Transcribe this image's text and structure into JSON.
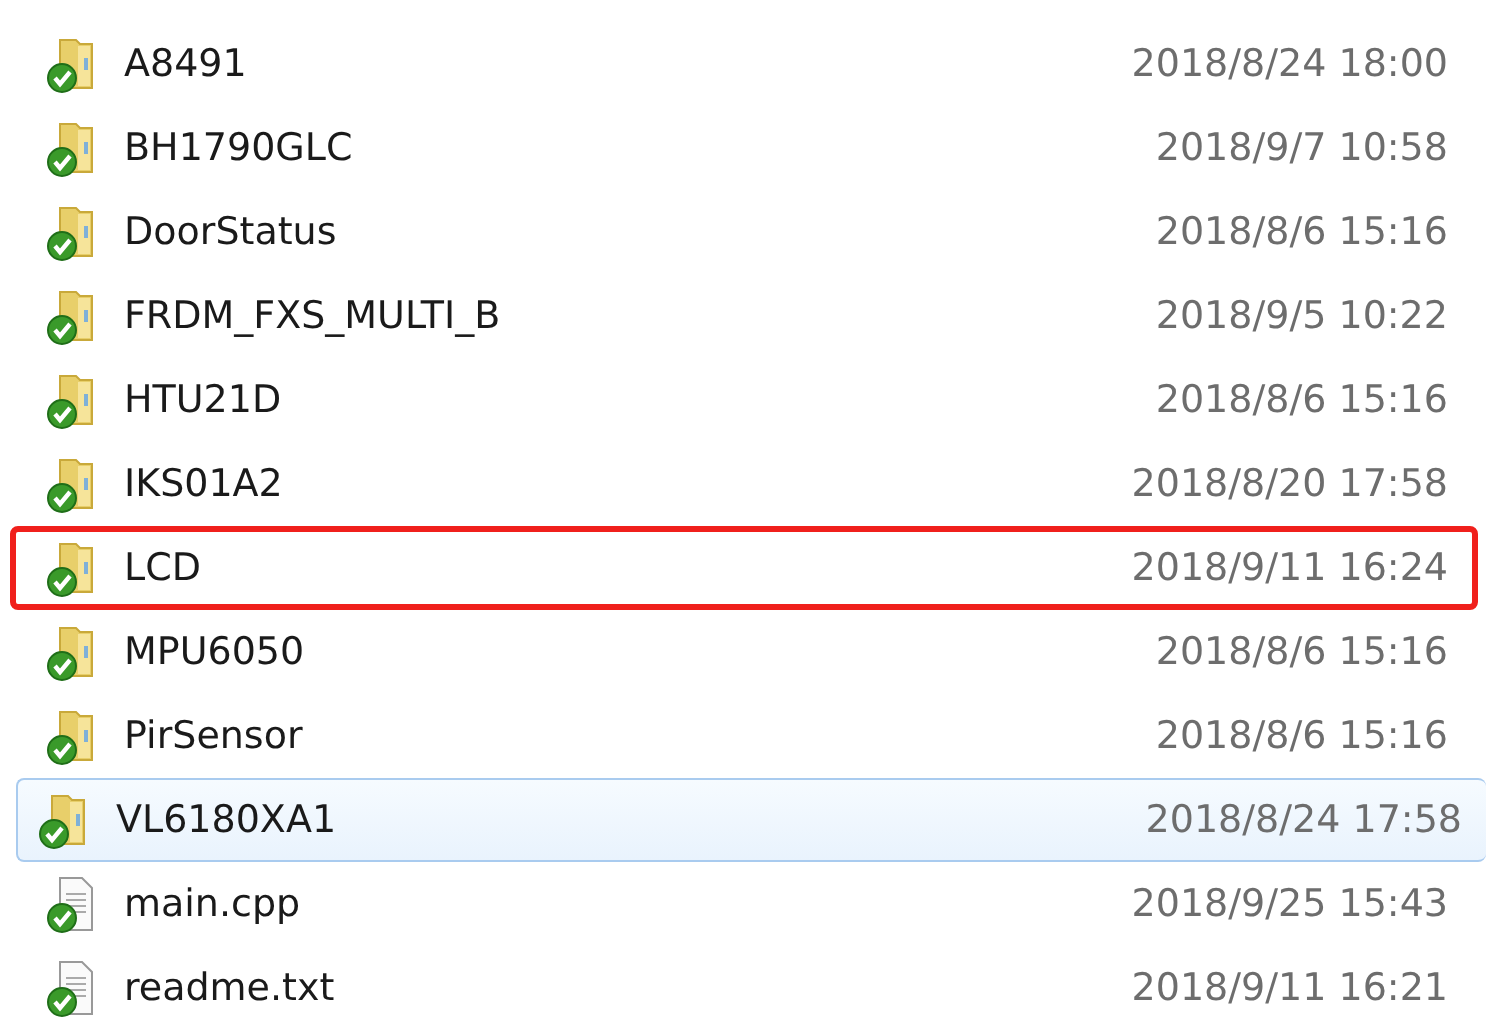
{
  "files": [
    {
      "kind": "folder",
      "name": "A8491",
      "modified": "2018/8/24 18:00",
      "hovered": false,
      "marked": false
    },
    {
      "kind": "folder",
      "name": "BH1790GLC",
      "modified": "2018/9/7 10:58",
      "hovered": false,
      "marked": false
    },
    {
      "kind": "folder",
      "name": "DoorStatus",
      "modified": "2018/8/6 15:16",
      "hovered": false,
      "marked": false
    },
    {
      "kind": "folder",
      "name": "FRDM_FXS_MULTI_B",
      "modified": "2018/9/5 10:22",
      "hovered": false,
      "marked": false
    },
    {
      "kind": "folder",
      "name": "HTU21D",
      "modified": "2018/8/6 15:16",
      "hovered": false,
      "marked": false
    },
    {
      "kind": "folder",
      "name": "IKS01A2",
      "modified": "2018/8/20 17:58",
      "hovered": false,
      "marked": false
    },
    {
      "kind": "folder",
      "name": "LCD",
      "modified": "2018/9/11 16:24",
      "hovered": false,
      "marked": true
    },
    {
      "kind": "folder",
      "name": "MPU6050",
      "modified": "2018/8/6 15:16",
      "hovered": false,
      "marked": false
    },
    {
      "kind": "folder",
      "name": "PirSensor",
      "modified": "2018/8/6 15:16",
      "hovered": false,
      "marked": false
    },
    {
      "kind": "folder",
      "name": "VL6180XA1",
      "modified": "2018/8/24 17:58",
      "hovered": true,
      "marked": false
    },
    {
      "kind": "file",
      "name": "main.cpp",
      "modified": "2018/9/25 15:43",
      "hovered": false,
      "marked": false
    },
    {
      "kind": "file",
      "name": "readme.txt",
      "modified": "2018/9/11 16:21",
      "hovered": false,
      "marked": false
    }
  ]
}
